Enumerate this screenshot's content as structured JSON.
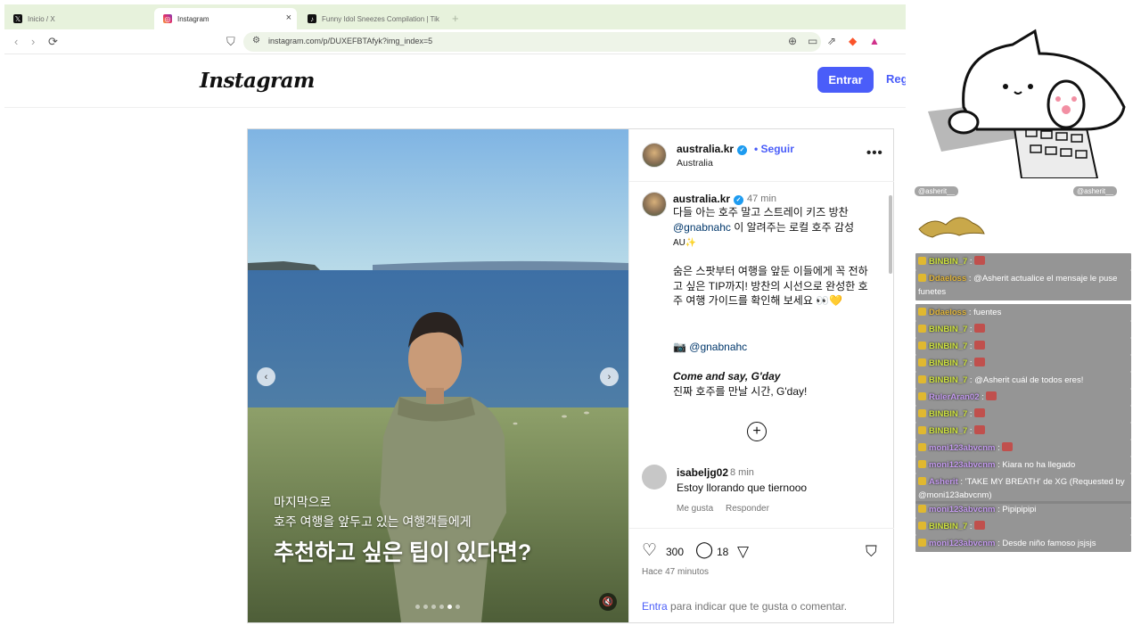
{
  "browser": {
    "tabs": [
      {
        "label": "Inicio / X",
        "icon": "x-logo-icon"
      },
      {
        "label": "Instagram",
        "icon": "instagram-icon"
      },
      {
        "label": "Funny Idol Sneezes Compilation | Tik",
        "icon": "tiktok-icon"
      }
    ],
    "new_tab": "+",
    "url": "instagram.com/p/DUXEFBTAfyk?img_index=5"
  },
  "instagram": {
    "logo": "Instagram",
    "login_button": "Entrar",
    "register_button": "Registrarse"
  },
  "post": {
    "username": "australia.kr",
    "follow": "• Seguir",
    "location": "Australia",
    "more_icon": "•••",
    "media_captions": [
      "마지막으로",
      "호주 여행을 앞두고 있는 여행객들에게",
      "추천하고 싶은 팁이 있다면?"
    ],
    "carousel_total": 6,
    "carousel_index": 4,
    "caption": {
      "time": "47 min",
      "line1": "다들 아는 호주 말고 스트레이 키즈 방찬",
      "mention": "@gnabnahc",
      "line2": " 이 알려주는 로컬 호주 감성",
      "line3": "AU✨",
      "para2": "숨은 스팟부터 여행을 앞둔 이들에게 꼭 전하고 싶은 TIP까지! 방찬의 시선으로 완성한 호주 여행 가이드를 확인해 보세요 👀💛",
      "camera_line": "📷 ",
      "camera_mention": "@gnabnahc",
      "title": "Come and say, G'day",
      "closing": "진짜 호주를 만날 시간, G'day!"
    },
    "comment": {
      "user": "isabeljg02",
      "time": "8 min",
      "text": "Estoy llorando que tiernooo",
      "like": "Me gusta",
      "reply": "Responder"
    },
    "likes": "300",
    "comments_count": "18",
    "posted_ago": "Hace 47 minutos",
    "login_link": "Entra",
    "login_prompt": " para indicar que te gusta o comentar."
  },
  "chat": {
    "header_left": "@asherit__",
    "header_right": "@asherit__",
    "messages": [
      {
        "user": "BINBIN_7",
        "sep": " : ",
        "text": "",
        "color": "y"
      },
      {
        "user": "Ddaeloss",
        "sep": " : ",
        "text": "@Asherit actualice el mensaje le puse funetes",
        "color": "o"
      },
      {
        "user": "Ddaeloss",
        "sep": " : ",
        "text": "fuentes",
        "color": "o"
      },
      {
        "user": "BINBIN_7",
        "sep": " : ",
        "text": "",
        "color": "y"
      },
      {
        "user": "BINBIN_7",
        "sep": " : ",
        "text": "",
        "color": "y"
      },
      {
        "user": "BINBIN_7",
        "sep": " : ",
        "text": "",
        "color": "y"
      },
      {
        "user": "BINBIN_7",
        "sep": " : ",
        "text": "@Asherit cuál de todos eres!",
        "color": "y"
      },
      {
        "user": "RulerAran02",
        "sep": " : ",
        "text": "",
        "color": "p"
      },
      {
        "user": "BINBIN_7",
        "sep": " : ",
        "text": "",
        "color": "y"
      },
      {
        "user": "BINBIN_7",
        "sep": " : ",
        "text": "",
        "color": "y"
      },
      {
        "user": "moni123abvcnm",
        "sep": " : ",
        "text": "",
        "color": "p"
      },
      {
        "user": "moni123abvcnm",
        "sep": " : ",
        "text": "Kiara no ha llegado",
        "color": "p"
      },
      {
        "user": "Asherit",
        "sep": " : ",
        "text": "'TAKE MY BREATH' de XG (Requested by @moni123abvcnm)",
        "color": "p"
      },
      {
        "user": "moni123abvcnm",
        "sep": " : ",
        "text": "Pipipipipi",
        "color": "p"
      },
      {
        "user": "BINBIN_7",
        "sep": " : ",
        "text": "",
        "color": "y"
      },
      {
        "user": "moni123abvcnm",
        "sep": " : ",
        "text": "Desde niño famoso jsjsjs",
        "color": "p"
      }
    ]
  },
  "colors": {
    "accent": "#4a5df9",
    "tabbar": "#e7f2dc",
    "chat_bg": "#828282"
  }
}
